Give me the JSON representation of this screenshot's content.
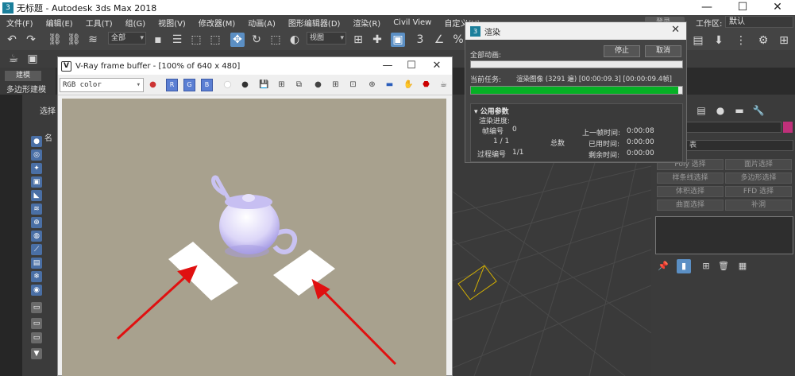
{
  "window": {
    "title": "无标题 - Autodesk 3ds Max 2018",
    "controls": [
      "—",
      "☐",
      "✕"
    ]
  },
  "menu": [
    "文件(F)",
    "编辑(E)",
    "工具(T)",
    "组(G)",
    "视图(V)",
    "修改器(M)",
    "动画(A)",
    "图形编辑器(D)",
    "渲染(R)",
    "Civil View",
    "自定义(U)"
  ],
  "search": {
    "placeholder": "登录"
  },
  "workspace": {
    "label": "工作区:",
    "value": "默认"
  },
  "toolbar": {
    "selection_filter": "全部",
    "ref_coord": "视图"
  },
  "ribbon": {
    "tab": "建模",
    "label": "多边形建模"
  },
  "left_panel": {
    "select_label": "选择",
    "name_col": "名"
  },
  "vfb": {
    "title": "V-Ray frame buffer - [100% of 640 x 480]",
    "channel": "RGB color",
    "controls": [
      "—",
      "☐",
      "✕"
    ]
  },
  "render_dialog": {
    "title": "渲染",
    "all_anim_label": "全部动画:",
    "stop_button": "停止",
    "cancel_button": "取消",
    "current_task_label": "当前任务:",
    "current_task_text": "渲染图像 (3291 遍) [00:00:09.3] [00:00:09.4帧]",
    "progress": 0.98,
    "section_title": "公用参数",
    "render_progress_label": "渲染进度:",
    "frame_label": "帧编号",
    "frame_value": "0",
    "frame_count": "1 / 1",
    "total_label": "总数",
    "last_frame_label": "上一帧时间:",
    "last_frame_value": "0:00:08",
    "elapsed_label": "已用时间:",
    "elapsed_value": "0:00:00",
    "pass_label": "过程编号",
    "pass_value": "1/1",
    "remaining_label": "剩余时间:",
    "remaining_value": "0:00:00"
  },
  "command_panel": {
    "dropdown": "表",
    "buttons": [
      "Poly 选择",
      "面片选择",
      "样条线选择",
      "多边形选择",
      "体积选择",
      "FFD 选择",
      "曲面选择",
      "补洞"
    ]
  }
}
